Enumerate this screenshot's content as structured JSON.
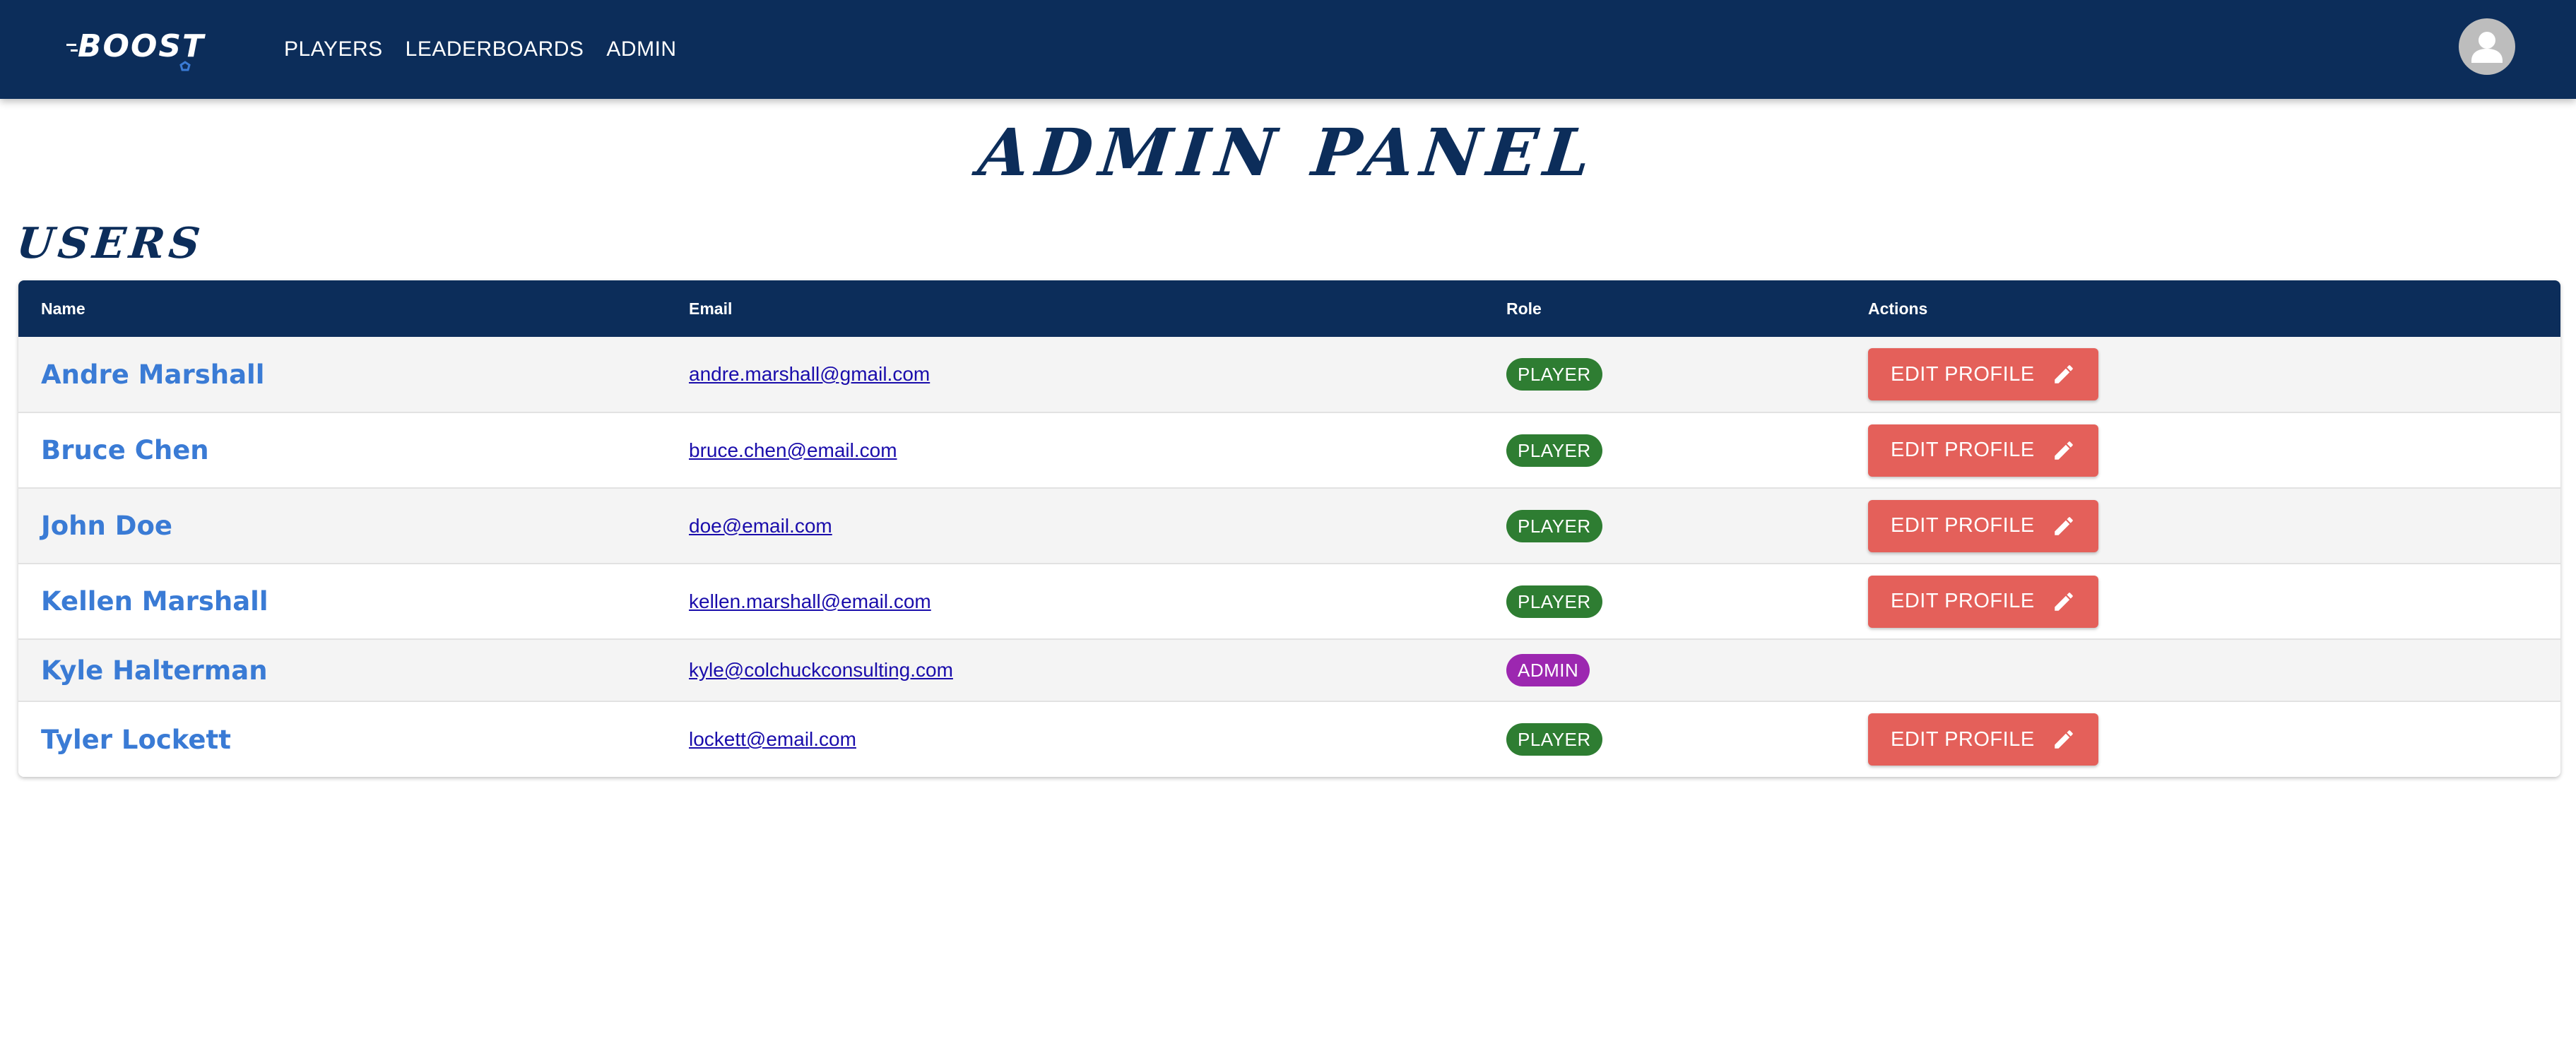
{
  "header": {
    "logo_text": "BOOST",
    "nav": [
      {
        "label": "PLAYERS"
      },
      {
        "label": "LEADERBOARDS"
      },
      {
        "label": "ADMIN"
      }
    ],
    "avatar_icon": "account-icon"
  },
  "page": {
    "title": "ADMIN PANEL",
    "section_title": "USERS"
  },
  "table": {
    "columns": [
      "Name",
      "Email",
      "Role",
      "Actions"
    ],
    "action_label": "EDIT PROFILE",
    "action_icon": "pencil-icon",
    "rows": [
      {
        "name": "Andre Marshall",
        "email": "andre.marshall@gmail.com",
        "role": "PLAYER"
      },
      {
        "name": "Bruce Chen",
        "email": "bruce.chen@email.com",
        "role": "PLAYER"
      },
      {
        "name": "John Doe",
        "email": "doe@email.com",
        "role": "PLAYER"
      },
      {
        "name": "Kellen Marshall",
        "email": "kellen.marshall@email.com",
        "role": "PLAYER"
      },
      {
        "name": "Kyle Halterman",
        "email": "kyle@colchuckconsulting.com",
        "role": "ADMIN"
      },
      {
        "name": "Tyler Lockett",
        "email": "lockett@email.com",
        "role": "PLAYER"
      }
    ]
  },
  "colors": {
    "primary": "#0c2d5a",
    "link_blue": "#3a7bd5",
    "player_chip": "#2e7d32",
    "admin_chip": "#9c27b0",
    "action_button": "#e4605a"
  }
}
